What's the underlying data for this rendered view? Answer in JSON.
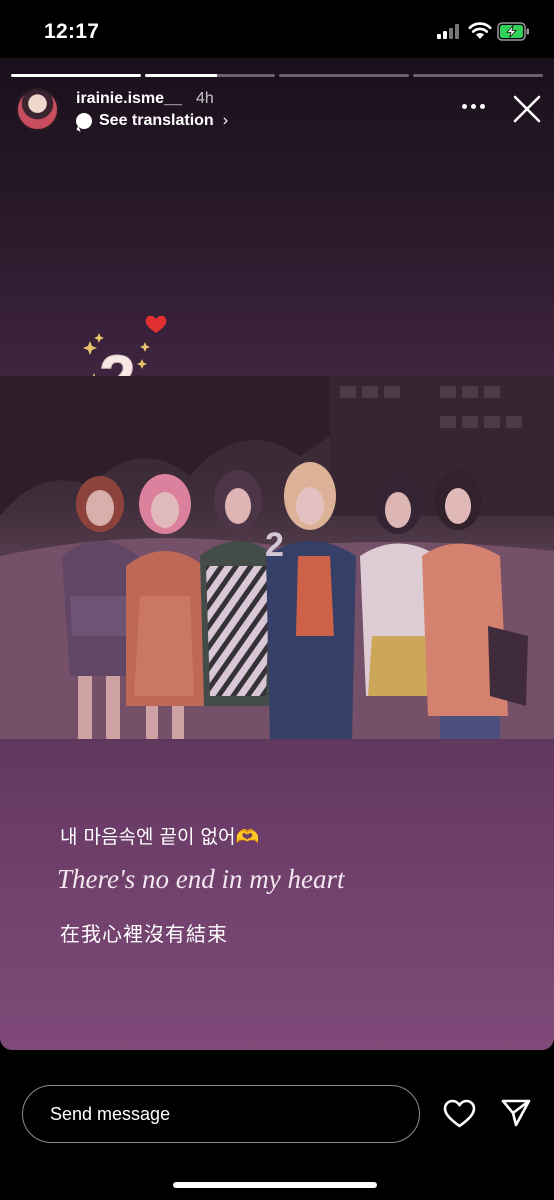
{
  "status_bar": {
    "time": "12:17",
    "signal_bars_active": 2,
    "signal_bars_total": 4,
    "battery_charging": true,
    "battery_color": "#30d158"
  },
  "progress": [
    1,
    0.55,
    0,
    0
  ],
  "header": {
    "username": "irainie.isme__",
    "time_ago": "4h",
    "translate_label": "See translation",
    "translate_chevron": "›",
    "more_icon": "more-horizontal-icon",
    "close_icon": "close-icon"
  },
  "sticker": {
    "number": "2",
    "heart": "❤️",
    "sparkles_color": "#e9c46a"
  },
  "photo": {
    "description_icon": "group-photo",
    "balloon_number": "2"
  },
  "captions": {
    "korean": "내 마음속엔 끝이 없어🫶",
    "english": "There's no end in my heart",
    "chinese": "在我心裡沒有結束"
  },
  "reply": {
    "placeholder": "Send message",
    "like_icon": "heart-icon",
    "share_icon": "send-icon"
  },
  "colors": {
    "background": "#000000",
    "story_top": "#1a0f1c",
    "story_bottom": "#7f4a79",
    "text": "#ffffff"
  }
}
